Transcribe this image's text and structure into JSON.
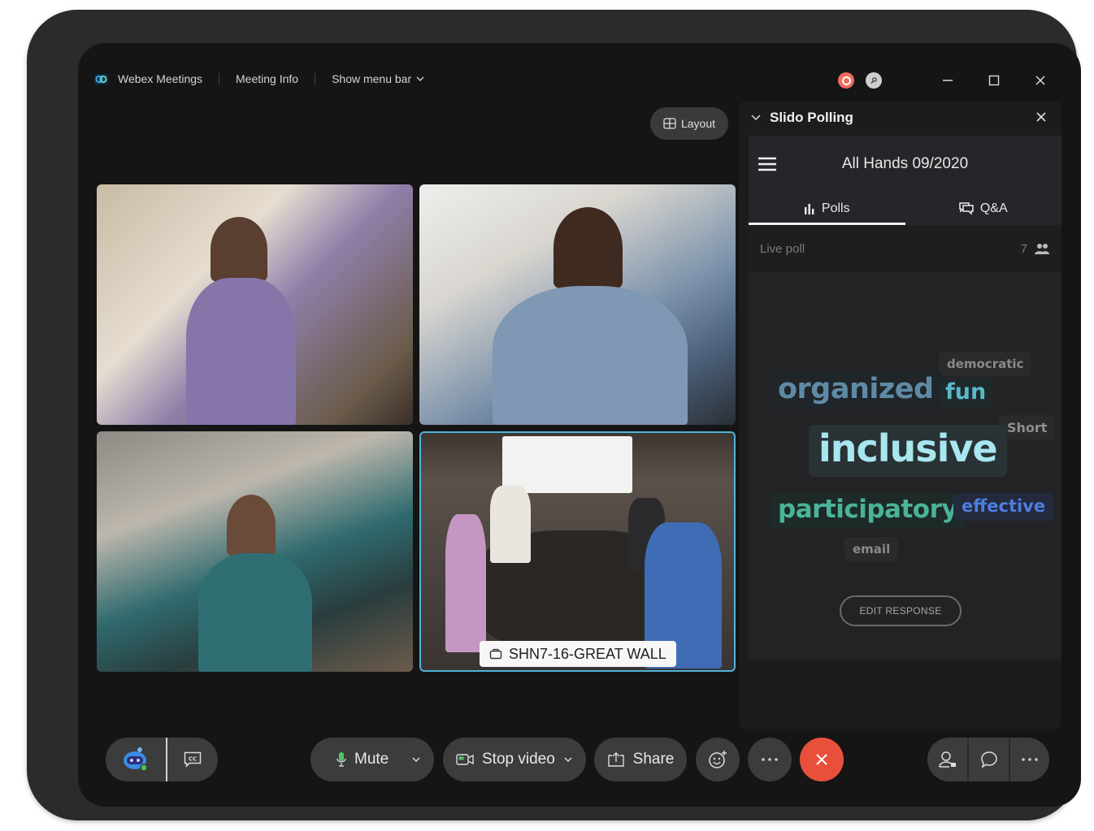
{
  "titlebar": {
    "app_name": "Webex Meetings",
    "meeting_info": "Meeting Info",
    "show_menu_bar": "Show menu bar",
    "recording_status_color": "#f26b5b"
  },
  "layout_button": {
    "label": "Layout",
    "icon": "grid-icon"
  },
  "video_grid": {
    "tiles": [
      {
        "description": "participant video",
        "active": false
      },
      {
        "description": "participant video",
        "active": false
      },
      {
        "description": "participant video",
        "active": false
      },
      {
        "description": "room video",
        "active": true,
        "label": "SHN7-16-GREAT WALL",
        "label_icon": "room-device-icon"
      }
    ],
    "active_border_color": "#4fb3d9"
  },
  "slido_panel": {
    "title": "Slido Polling",
    "event_name": "All Hands 09/2020",
    "tabs": [
      {
        "label": "Polls",
        "icon": "bar-chart-icon",
        "active": true
      },
      {
        "label": "Q&A",
        "icon": "chat-bubbles-icon",
        "active": false
      }
    ],
    "live_poll_label": "Live poll",
    "participant_count": "7",
    "word_cloud": [
      {
        "word": "democratic",
        "color": "#8a8a8a"
      },
      {
        "word": "organized",
        "color": "#5f8aa6"
      },
      {
        "word": "fun",
        "color": "#59b9c9"
      },
      {
        "word": "Short",
        "color": "#8f8f8f"
      },
      {
        "word": "inclusive",
        "color": "#a8e6f0"
      },
      {
        "word": "participatory",
        "color": "#4ab39a"
      },
      {
        "word": "effective",
        "color": "#4d7ee0"
      },
      {
        "word": "email",
        "color": "#8a8a8a"
      }
    ],
    "edit_response_label": "EDIT RESPONSE"
  },
  "controls": {
    "assistant_icon": "webex-assistant-icon",
    "captions_icon": "closed-captions-icon",
    "mute_label": "Mute",
    "stop_video_label": "Stop video",
    "share_label": "Share",
    "reactions_icon": "emoji-icon",
    "more_icon": "more-icon",
    "end_call_icon": "close-icon",
    "end_call_color": "#e8503c",
    "participants_icon": "participants-icon",
    "chat_icon": "chat-icon",
    "more_options_icon": "more-icon"
  }
}
